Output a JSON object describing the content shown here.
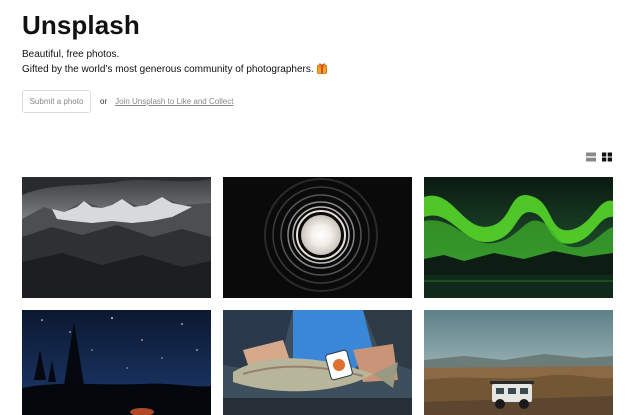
{
  "header": {
    "title": "Unsplash",
    "tagline_line1": "Beautiful, free photos.",
    "tagline_line2": "Gifted by the world’s most generous community of photographers."
  },
  "actions": {
    "submit_label": "Submit a photo",
    "or_label": "or",
    "join_label": "Join Unsplash to Like and Collect"
  },
  "view_toggles": [
    {
      "icon": "list-view-icon",
      "active": false
    },
    {
      "icon": "grid-view-icon",
      "active": true
    }
  ],
  "photos": [
    {
      "subject": "mountain-range",
      "colors": [
        "#1c1e1f",
        "#8a8c8e"
      ]
    },
    {
      "subject": "light-rings",
      "colors": [
        "#0a0a0a",
        "#e8e4dc"
      ]
    },
    {
      "subject": "aurora",
      "colors": [
        "#0b1a12",
        "#5ae02a"
      ]
    },
    {
      "subject": "starry-night",
      "colors": [
        "#0c1830",
        "#1c3a6e"
      ]
    },
    {
      "subject": "fish-catch",
      "colors": [
        "#2b4060",
        "#3a86d8"
      ]
    },
    {
      "subject": "truck-landscape",
      "colors": [
        "#6f9098",
        "#8a6a44"
      ]
    }
  ],
  "colors": {
    "text": "#111111",
    "muted": "#888888",
    "border": "#dcdcdc"
  }
}
